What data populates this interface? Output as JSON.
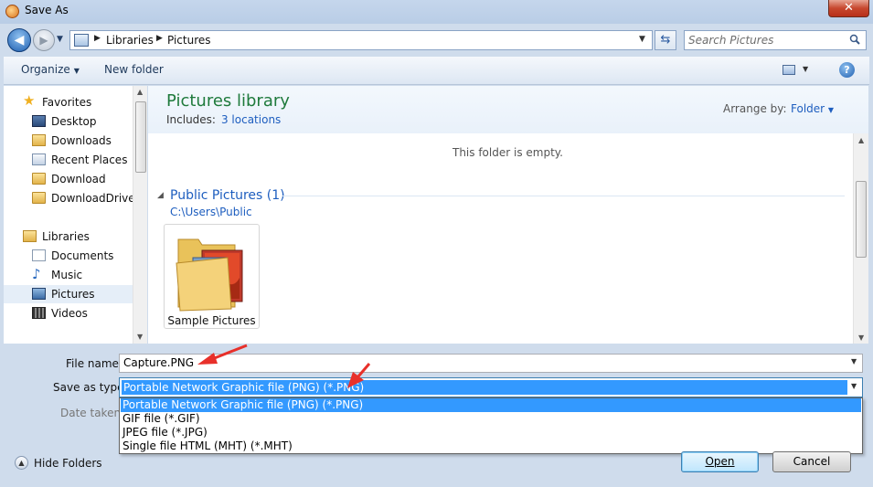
{
  "window": {
    "title": "Save As",
    "close_glyph": "✕"
  },
  "address_bar": {
    "crumbs": [
      "Libraries",
      "Pictures"
    ],
    "search_placeholder": "Search Pictures"
  },
  "toolbar": {
    "organize_label": "Organize",
    "new_folder_label": "New folder",
    "help_glyph": "?"
  },
  "sidebar": {
    "favorites_label": "Favorites",
    "favorites": [
      "Desktop",
      "Downloads",
      "Recent Places",
      "Download",
      "DownloadDriver"
    ],
    "libraries_label": "Libraries",
    "libraries": [
      "Documents",
      "Music",
      "Pictures",
      "Videos"
    ],
    "selected": "Pictures"
  },
  "library": {
    "title": "Pictures library",
    "includes_label": "Includes:",
    "includes_link": "3 locations",
    "arrange_label": "Arrange by:",
    "arrange_value": "Folder",
    "empty_message": "This folder is empty.",
    "group_title": "Public Pictures (1)",
    "group_path": "C:\\Users\\Public",
    "items": [
      {
        "label": "Sample Pictures",
        "icon": "folder-icon"
      }
    ]
  },
  "form": {
    "file_name_label": "File name:",
    "file_name_value": "Capture.PNG",
    "save_type_label": "Save as type:",
    "save_type_value": "Portable Network Graphic file (PNG) (*.PNG)",
    "save_type_options": [
      "Portable Network Graphic file (PNG) (*.PNG)",
      "GIF file (*.GIF)",
      "JPEG file (*.JPG)",
      "Single file HTML (MHT) (*.MHT)"
    ],
    "date_taken_label": "Date taken:"
  },
  "footer": {
    "hide_folders_label": "Hide Folders",
    "open_label": "Open",
    "cancel_label": "Cancel"
  },
  "colors": {
    "accent": "#1e5ebf",
    "library_title": "#1f7a3c",
    "selection": "#3399ff",
    "annotation_arrow": "#e8302a"
  }
}
